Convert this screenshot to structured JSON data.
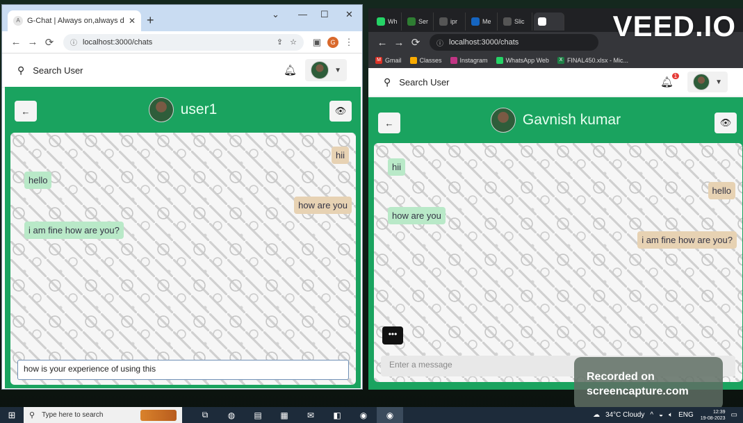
{
  "overlays": {
    "veed_logo": "VEED.IO",
    "recorder_line1": "Recorded on",
    "recorder_line2": "screencapture.com"
  },
  "left_window": {
    "tab_title": "G-Chat | Always on,always delig",
    "new_tab": "+",
    "url": "localhost:3000/chats",
    "app": {
      "search_label": "Search User"
    },
    "chat": {
      "peer_name": "user1",
      "messages": [
        {
          "text": "hii",
          "dir": "sent"
        },
        {
          "text": "hello",
          "dir": "recv"
        },
        {
          "text": "how are you",
          "dir": "sent"
        },
        {
          "text": "i am fine how are you?",
          "dir": "recv"
        }
      ],
      "input_value": "how is your experience of using this"
    }
  },
  "right_window": {
    "tabs": [
      "Wh",
      "Ser",
      "ipr",
      "Me",
      "Slic",
      ""
    ],
    "url": "localhost:3000/chats",
    "bookmarks": [
      "Gmail",
      "Classes",
      "Instagram",
      "WhatsApp Web",
      "FINAL450.xlsx - Mic..."
    ],
    "app": {
      "search_label": "Search User",
      "notif_count": "1"
    },
    "chat": {
      "peer_name": "Gavnish kumar",
      "messages": [
        {
          "text": "hii",
          "dir": "recv"
        },
        {
          "text": "hello",
          "dir": "sent"
        },
        {
          "text": "how are you",
          "dir": "recv"
        },
        {
          "text": "i am fine how are you?",
          "dir": "sent"
        }
      ],
      "input_placeholder": "Enter a message"
    }
  },
  "taskbar": {
    "search_placeholder": "Type here to search",
    "weather": "34°C  Cloudy",
    "lang": "ENG",
    "time": "12:39",
    "date": "19-08-2023"
  }
}
